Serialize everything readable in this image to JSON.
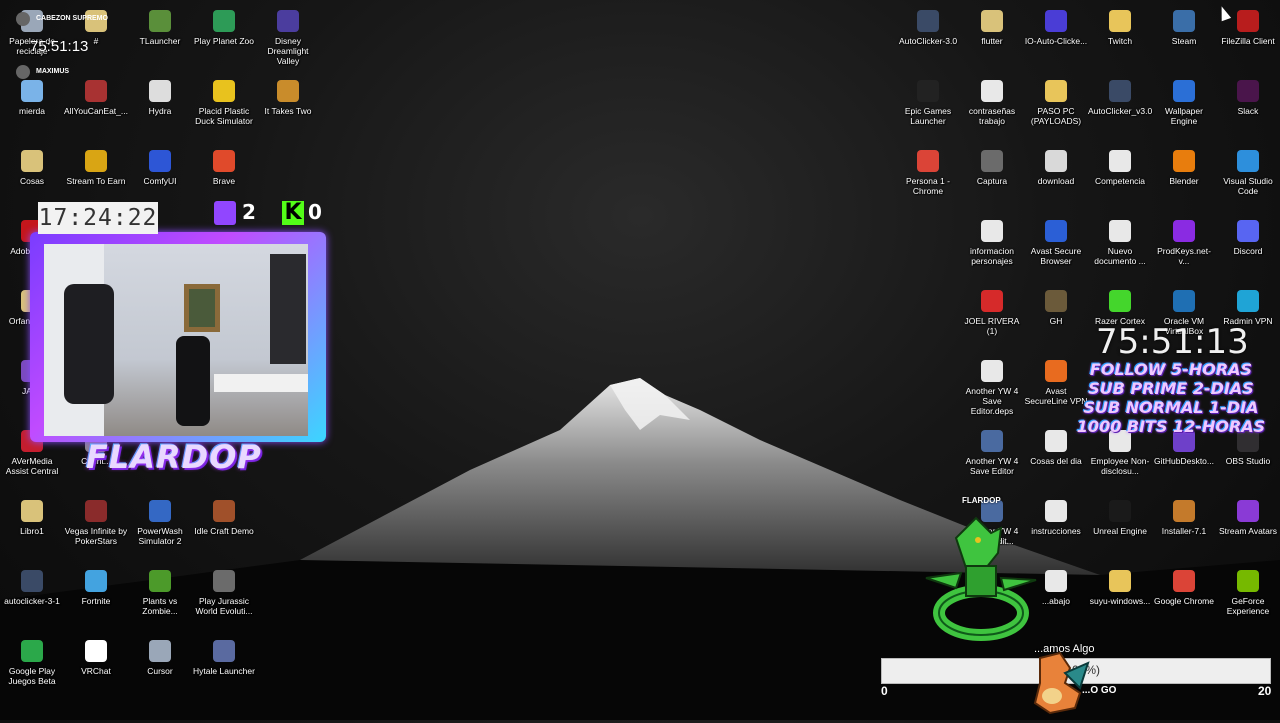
{
  "desktop": {
    "icons": [
      {
        "label": "Papelera de reciclaje",
        "icon": "recycle-bin-icon",
        "color": "#9aa7b8"
      },
      {
        "label": "#",
        "icon": "folder-icon",
        "color": "#d9c27a"
      },
      {
        "label": "TLauncher",
        "icon": "minecraft-icon",
        "color": "#5a8f3a"
      },
      {
        "label": "Play Planet Zoo",
        "icon": "planet-zoo-icon",
        "color": "#2d9b57"
      },
      {
        "label": "Disney Dreamlight Valley",
        "icon": "disney-icon",
        "color": "#4b3d9e"
      },
      {
        "label": "mierda",
        "icon": "file-icon",
        "color": "#7ab3e8"
      },
      {
        "label": "AllYouCanEat_...",
        "icon": "game-icon",
        "color": "#a83232"
      },
      {
        "label": "Hydra",
        "icon": "hydra-icon",
        "color": "#dddddd"
      },
      {
        "label": "Placid Plastic Duck Simulator",
        "icon": "duck-icon",
        "color": "#e8c21e"
      },
      {
        "label": "It Takes Two",
        "icon": "it-takes-two-icon",
        "color": "#c98c2b"
      },
      {
        "label": "Cosas",
        "icon": "folder-icon",
        "color": "#d9c27a"
      },
      {
        "label": "Stream To Earn",
        "icon": "stream-to-earn-icon",
        "color": "#d9a514"
      },
      {
        "label": "ComfyUI",
        "icon": "comfyui-icon",
        "color": "#2d56d6"
      },
      {
        "label": "Brave",
        "icon": "brave-icon",
        "color": "#e04a2b"
      },
      {
        "label": "Adobe Ac...",
        "icon": "adobe-icon",
        "color": "#c4161c"
      },
      {
        "label": "OrfanatoC...",
        "icon": "folder-icon",
        "color": "#d9c27a"
      },
      {
        "label": "JAVA",
        "icon": "java-icon",
        "color": "#7a4bbd"
      },
      {
        "label": "AVerMedia Assist Central",
        "icon": "avermedia-icon",
        "color": "#c41e2e"
      },
      {
        "label": "Count...",
        "icon": "file-icon",
        "color": "#8a8a8a"
      },
      {
        "label": "Libro1",
        "icon": "excel-file-icon",
        "color": "#d9c27a"
      },
      {
        "label": "Vegas Infinite by PokerStars",
        "icon": "poker-icon",
        "color": "#8a2b2b"
      },
      {
        "label": "PowerWash Simulator 2",
        "icon": "powerwash-icon",
        "color": "#3468c4"
      },
      {
        "label": "Idle Craft Demo",
        "icon": "idle-craft-icon",
        "color": "#a0502a"
      },
      {
        "label": "autoclicker-3-1",
        "icon": "autoclicker-icon",
        "color": "#3a4a66"
      },
      {
        "label": "Fortnite",
        "icon": "fortnite-icon",
        "color": "#43a3e0"
      },
      {
        "label": "Plants vs Zombie...",
        "icon": "pvz-icon",
        "color": "#4c9a2a"
      },
      {
        "label": "Play Jurassic World Evoluti...",
        "icon": "jurassic-icon",
        "color": "#6b6b6b"
      },
      {
        "label": "Google Play Juegos Beta",
        "icon": "google-play-icon",
        "color": "#2ba84a"
      },
      {
        "label": "VRChat",
        "icon": "vrchat-icon",
        "color": "#ffffff"
      },
      {
        "label": "Cursor",
        "icon": "cursor-app-icon",
        "color": "#9aa7b8"
      },
      {
        "label": "Hytale Launcher",
        "icon": "hytale-icon",
        "color": "#5a6aa0"
      },
      {
        "label": "AutoClicker-3.0",
        "icon": "autoclicker-icon",
        "color": "#3a4a66"
      },
      {
        "label": "flutter",
        "icon": "folder-icon",
        "color": "#d9c27a"
      },
      {
        "label": "IO-Auto-Clicke...",
        "icon": "io-autoclicker-icon",
        "color": "#4a3dd6"
      },
      {
        "label": "Twitch",
        "icon": "folder-icon",
        "color": "#e8c55a"
      },
      {
        "label": "Steam",
        "icon": "steam-icon",
        "color": "#3a6ea8"
      },
      {
        "label": "FileZilla Client",
        "icon": "filezilla-icon",
        "color": "#b81d1d"
      },
      {
        "label": "Epic Games Launcher",
        "icon": "epic-games-icon",
        "color": "#222222"
      },
      {
        "label": "contraseñas trabajo",
        "icon": "text-file-icon",
        "color": "#e8e8e8"
      },
      {
        "label": "PASO PC (PAYLOADS)",
        "icon": "folder-icon",
        "color": "#e8c55a"
      },
      {
        "label": "AutoClicker_v3.0",
        "icon": "autoclicker-icon",
        "color": "#3a4a66"
      },
      {
        "label": "Wallpaper Engine",
        "icon": "wallpaper-engine-icon",
        "color": "#2b6fd6"
      },
      {
        "label": "Slack",
        "icon": "slack-icon",
        "color": "#4a154b"
      },
      {
        "label": "Persona 1 - Chrome",
        "icon": "chrome-icon",
        "color": "#db4437"
      },
      {
        "label": "Captura",
        "icon": "image-file-icon",
        "color": "#6b6b6b"
      },
      {
        "label": "download",
        "icon": "image-file-icon",
        "color": "#d9d9d9"
      },
      {
        "label": "Competencia",
        "icon": "word-file-icon",
        "color": "#e8e8e8"
      },
      {
        "label": "Blender",
        "icon": "blender-icon",
        "color": "#e87d0d"
      },
      {
        "label": "Visual Studio Code",
        "icon": "vscode-icon",
        "color": "#2d8fdc"
      },
      {
        "label": "informacion personajes",
        "icon": "text-file-icon",
        "color": "#e8e8e8"
      },
      {
        "label": "Avast Secure Browser",
        "icon": "avast-browser-icon",
        "color": "#2b5fd6"
      },
      {
        "label": "Nuevo documento ...",
        "icon": "text-file-icon",
        "color": "#e8e8e8"
      },
      {
        "label": "ProdKeys.net-v...",
        "icon": "winrar-icon",
        "color": "#8a2be2"
      },
      {
        "label": "Discord",
        "icon": "discord-icon",
        "color": "#5865f2"
      },
      {
        "label": "JOEL RIVERA (1)",
        "icon": "pdf-file-icon",
        "color": "#d62a2a"
      },
      {
        "label": "GH",
        "icon": "folder-icon",
        "color": "#6b5a3a"
      },
      {
        "label": "Razer Cortex",
        "icon": "razer-icon",
        "color": "#44d62c"
      },
      {
        "label": "Oracle VM VirtualBox",
        "icon": "virtualbox-icon",
        "color": "#1f6fb3"
      },
      {
        "label": "Radmin VPN",
        "icon": "radmin-vpn-icon",
        "color": "#1fa4d6"
      },
      {
        "label": "Another YW 4 Save Editor.deps",
        "icon": "file-icon",
        "color": "#e8e8e8"
      },
      {
        "label": "Avast SecureLine VPN",
        "icon": "avast-vpn-icon",
        "color": "#e86b1f"
      },
      {
        "label": "Another YW 4 Save Editor",
        "icon": "yokai-icon",
        "color": "#4a6aa0"
      },
      {
        "label": "Cosas del dia",
        "icon": "text-file-icon",
        "color": "#e8e8e8"
      },
      {
        "label": "Employee Non-disclosu...",
        "icon": "pdf-file-icon",
        "color": "#e8e8e8"
      },
      {
        "label": "GitHubDeskto...",
        "icon": "github-desktop-icon",
        "color": "#6e40c9"
      },
      {
        "label": "OBS Studio",
        "icon": "obs-icon",
        "color": "#302e31"
      },
      {
        "label": "Another YW 4 Save Edit...",
        "icon": "yokai-icon",
        "color": "#4a6aa0"
      },
      {
        "label": "instrucciones",
        "icon": "text-file-icon",
        "color": "#e8e8e8"
      },
      {
        "label": "Unreal Engine",
        "icon": "unreal-icon",
        "color": "#1a1a1a"
      },
      {
        "label": "Installer-7.1",
        "icon": "installer-icon",
        "color": "#c47a2b"
      },
      {
        "label": "Stream Avatars",
        "icon": "stream-avatars-icon",
        "color": "#8a3ad6"
      },
      {
        "label": "...abajo",
        "icon": "file-icon",
        "color": "#e8e8e8"
      },
      {
        "label": "suyu-windows...",
        "icon": "folder-icon",
        "color": "#e8c55a"
      },
      {
        "label": "Google Chrome",
        "icon": "chrome-icon",
        "color": "#db4437"
      },
      {
        "label": "GeForce Experience",
        "icon": "geforce-icon",
        "color": "#76b900"
      }
    ]
  },
  "overlay": {
    "chat_users": [
      "CABEZON SUPREMO",
      "MAXIMUS"
    ],
    "small_clock": "75:51:13",
    "local_time": "17:24:22",
    "twitch_count": "2",
    "kick_count": "0",
    "streamer_name": "FLARDOP",
    "subathon_timer": "75:51:13",
    "promo_lines": [
      "FOLLOW 5-HORAS",
      "SUB PRIME 2-DIAS",
      "SUB NORMAL 1-DIA",
      "1000 BITS 12-HORAS"
    ],
    "dragon_label": "FLARDOP",
    "goal": {
      "title": "...amos Algo",
      "percent_text": "(0.00%)",
      "progress": 0.0,
      "min": "0",
      "max": "20",
      "tag": "...O GO"
    }
  },
  "colors": {
    "accent_purple": "#a040ff",
    "accent_cyan": "#3bd6ff",
    "kick_green": "#53fc18",
    "twitch_purple": "#9146ff"
  }
}
